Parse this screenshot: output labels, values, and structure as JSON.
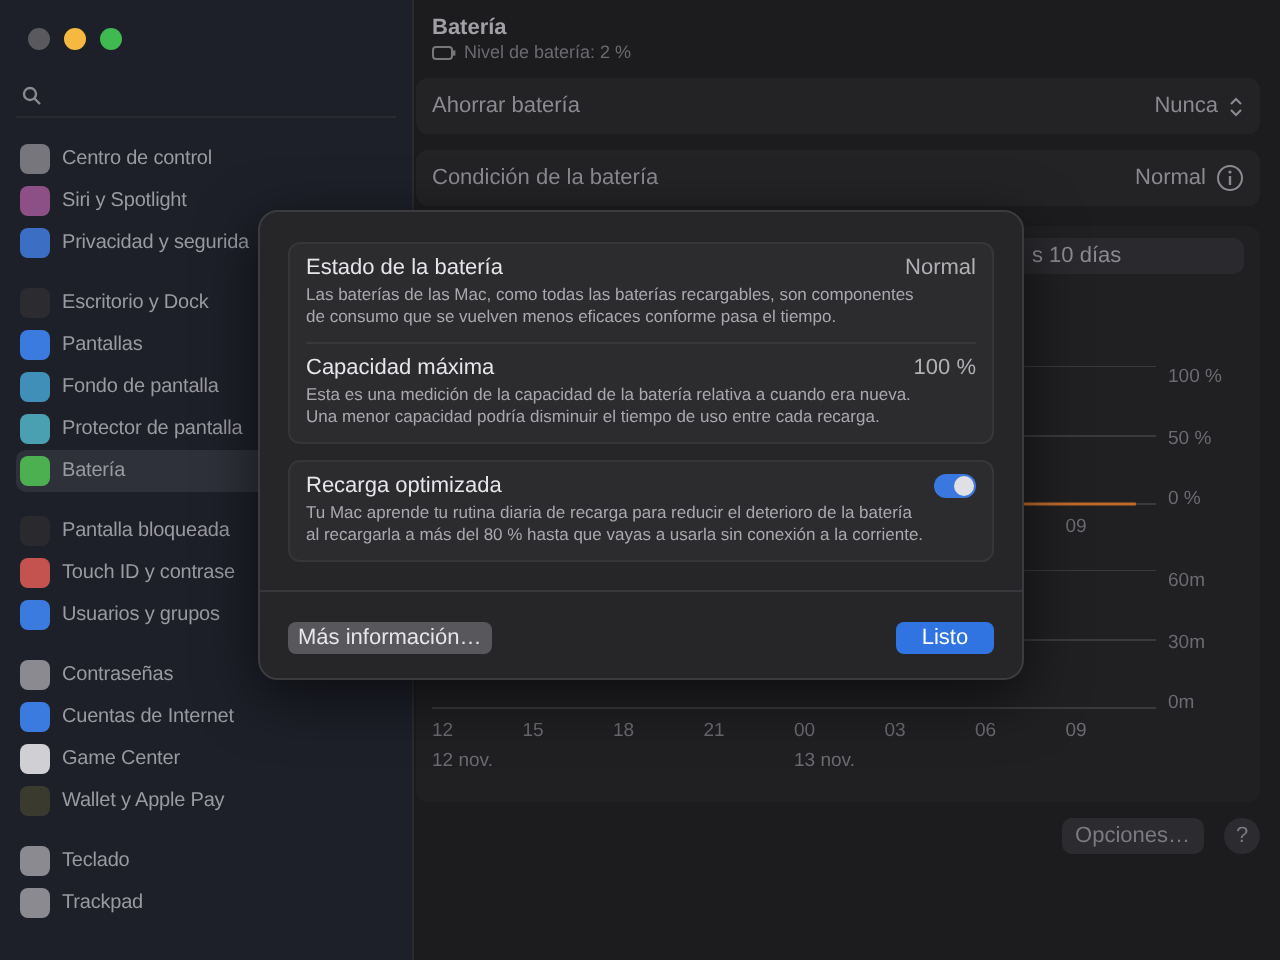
{
  "window": {
    "controls": [
      {
        "color": "#5a5a5e"
      },
      {
        "color": "#f5b93f"
      },
      {
        "color": "#3fb950"
      }
    ]
  },
  "sidebar": {
    "groups": [
      [
        {
          "label": "Centro de control",
          "color": "#76767c",
          "selected": false
        },
        {
          "label": "Siri y Spotlight",
          "color": "#8c4f86",
          "selected": false
        },
        {
          "label": "Privacidad y segurida",
          "color": "#3c6fc4",
          "selected": false
        }
      ],
      [
        {
          "label": "Escritorio y Dock",
          "color": "#2c2c30",
          "selected": false
        },
        {
          "label": "Pantallas",
          "color": "#3b7be0",
          "selected": false
        },
        {
          "label": "Fondo de pantalla",
          "color": "#3f8fb8",
          "selected": false
        },
        {
          "label": "Protector de pantalla",
          "color": "#4aa0b0",
          "selected": false
        },
        {
          "label": "Batería",
          "color": "#4caf50",
          "selected": true
        }
      ],
      [
        {
          "label": "Pantalla bloqueada",
          "color": "#2a2a2e",
          "selected": false
        },
        {
          "label": "Touch ID y contrase",
          "color": "#c4524e",
          "selected": false
        },
        {
          "label": "Usuarios y grupos",
          "color": "#3b7be0",
          "selected": false
        }
      ],
      [
        {
          "label": "Contraseñas",
          "color": "#8a8a90",
          "selected": false
        },
        {
          "label": "Cuentas de Internet",
          "color": "#3b7be0",
          "selected": false
        },
        {
          "label": "Game Center",
          "color": "#d0d0d4",
          "selected": false
        },
        {
          "label": "Wallet y Apple Pay",
          "color": "#3a3a2e",
          "selected": false
        }
      ],
      [
        {
          "label": "Teclado",
          "color": "#8a8a90",
          "selected": false
        },
        {
          "label": "Trackpad",
          "color": "#8a8a90",
          "selected": false
        }
      ]
    ]
  },
  "header": {
    "title": "Batería",
    "subtitle": "Nivel de batería: 2 %"
  },
  "rows": [
    {
      "label": "Ahorrar batería",
      "value": "Nunca",
      "kind": "popup"
    },
    {
      "label": "Condición de la batería",
      "value": "Normal",
      "kind": "info"
    }
  ],
  "chart_panel": {
    "tab": "s 10 días",
    "upper": {
      "y_labels": [
        "100 %",
        "50 %",
        "0 %"
      ],
      "x_labels": [
        "09"
      ]
    },
    "lower": {
      "y_labels": [
        "60m",
        "30m",
        "0m"
      ],
      "x_labels": [
        "12",
        "15",
        "18",
        "21",
        "00",
        "03",
        "06",
        "09"
      ],
      "dates": [
        "12 nov.",
        "13 nov."
      ]
    }
  },
  "footer": {
    "options": "Opciones…",
    "help": "?"
  },
  "dialog": {
    "cards": [
      [
        {
          "title": "Estado de la batería",
          "value": "Normal",
          "kind": "value",
          "description": "Las baterías de las Mac, como todas las baterías recargables, son componentes de consumo que se vuelven menos eficaces conforme pasa el tiempo."
        },
        {
          "title": "Capacidad máxima",
          "value": "100 %",
          "kind": "value",
          "description": "Esta es una medición de la capacidad de la batería relativa a cuando era nueva. Una menor capacidad podría disminuir el tiempo de uso entre cada recarga."
        }
      ],
      [
        {
          "title": "Recarga optimizada",
          "on": true,
          "kind": "toggle",
          "description": "Tu Mac aprende tu rutina diaria de recarga para reducir el deterioro de la batería al recargarla a más del 80 % hasta que vayas a usarla sin conexión a la corriente."
        }
      ]
    ],
    "more_button": "Más información…",
    "done_button": "Listo"
  }
}
